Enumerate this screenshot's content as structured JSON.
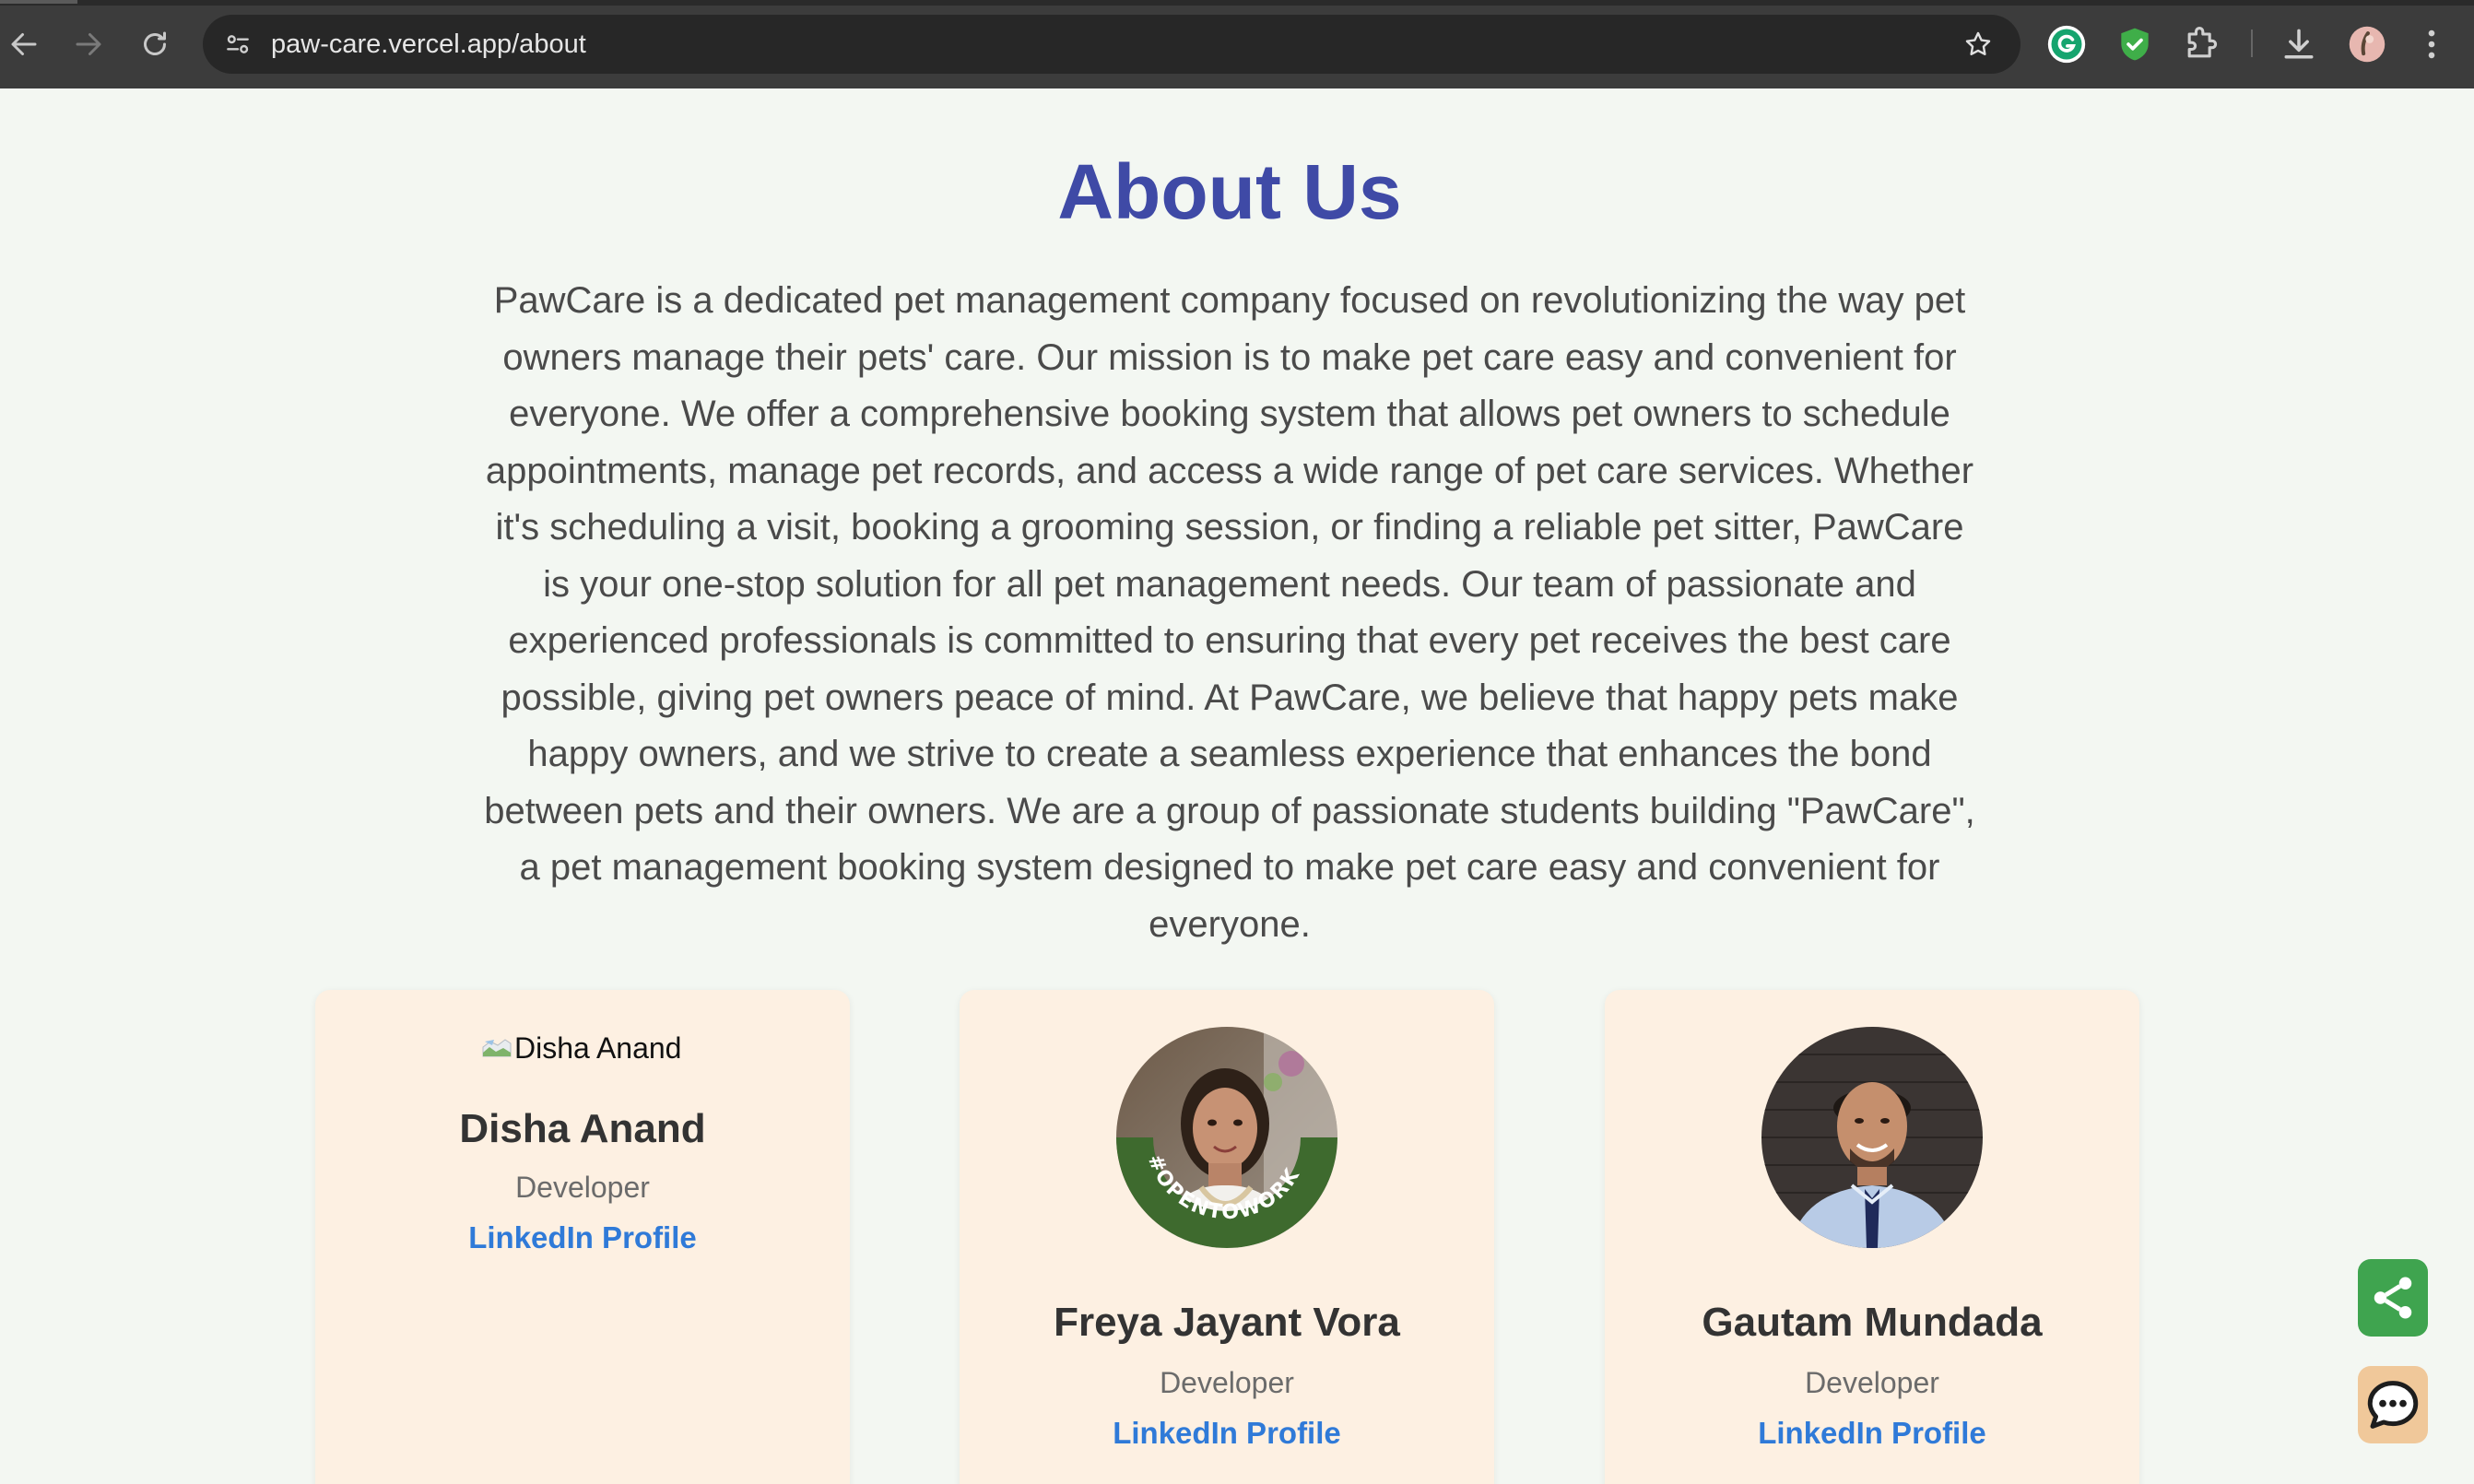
{
  "browser": {
    "url": "paw-care.vercel.app/about"
  },
  "page": {
    "title": "About Us",
    "description": "PawCare is a dedicated pet management company focused on revolutionizing the way pet owners manage their pets' care. Our mission is to make pet care easy and convenient for everyone. We offer a comprehensive booking system that allows pet owners to schedule appointments, manage pet records, and access a wide range of pet care services. Whether it's scheduling a visit, booking a grooming session, or finding a reliable pet sitter, PawCare is your one-stop solution for all pet management needs. Our team of passionate and experienced professionals is committed to ensuring that every pet receives the best care possible, giving pet owners peace of mind. At PawCare, we believe that happy pets make happy owners, and we strive to create a seamless experience that enhances the bond between pets and their owners. We are a group of passionate students building \"PawCare\", a pet management booking system designed to make pet care easy and convenient for everyone."
  },
  "team": [
    {
      "name": "Disha Anand",
      "role": "Developer",
      "link_label": "LinkedIn Profile",
      "image_alt": "Disha Anand"
    },
    {
      "name": "Freya Jayant Vora",
      "role": "Developer",
      "link_label": "LinkedIn Profile",
      "badge_text": "#OPENTOWORK"
    },
    {
      "name": "Gautam Mundada",
      "role": "Developer",
      "link_label": "LinkedIn Profile"
    }
  ],
  "colors": {
    "title": "#3f4aa6",
    "link": "#2f7ad8",
    "card_bg": "#fdf0e2",
    "share_fab": "#3fa44f",
    "chat_fab": "#f0c89a"
  },
  "icons": {
    "back": "back-arrow-icon",
    "forward": "forward-arrow-icon",
    "reload": "reload-icon",
    "site_info": "site-info-icon",
    "bookmark": "star-icon",
    "grammarly": "grammarly-icon",
    "shield": "shield-check-icon",
    "extensions": "puzzle-icon",
    "downloads": "download-icon",
    "profile": "profile-avatar-icon",
    "menu": "kebab-menu-icon",
    "share": "share-icon",
    "chat": "chat-icon"
  }
}
